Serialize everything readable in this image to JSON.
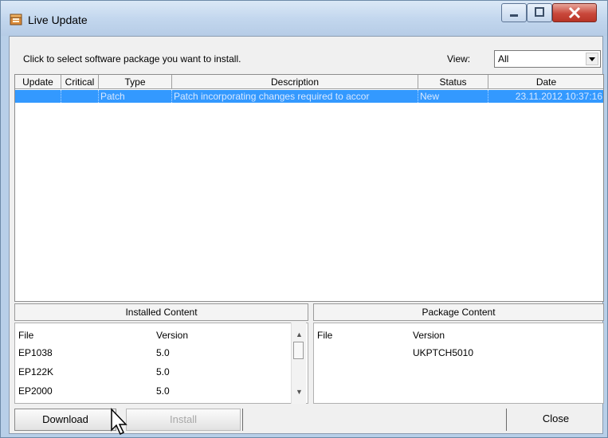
{
  "window": {
    "title": "Live Update",
    "app_icon": "box-package-icon",
    "controls": [
      "minimize-icon",
      "maximize-icon",
      "close-icon"
    ]
  },
  "header": {
    "instruction": "Click to select software package you want  to install.",
    "view_label": "View:",
    "view_value": "All"
  },
  "list": {
    "columns": [
      "Update",
      "Critical",
      "Type",
      "Description",
      "Status",
      "Date"
    ],
    "rows": [
      {
        "update": "",
        "critical": "",
        "type": "Patch",
        "description": "Patch incorporating changes required to accor",
        "status": "New",
        "date": "23.11.2012 10:37:16"
      }
    ]
  },
  "installed": {
    "title": "Installed Content",
    "file_header": "File",
    "version_header": "Version",
    "rows": [
      {
        "file": "EP1038",
        "version": "5.0"
      },
      {
        "file": "EP122K",
        "version": "5.0"
      },
      {
        "file": "EP2000",
        "version": "5.0"
      }
    ]
  },
  "package": {
    "title": "Package Content",
    "file_header": "File",
    "version_header": "Version",
    "rows": [
      {
        "file": "",
        "version": "UKPTCH5010"
      }
    ]
  },
  "footer": {
    "download_label": "Download",
    "install_label": "Install",
    "close_label": "Close"
  },
  "colors": {
    "selection": "#3399ff",
    "selection_text": "#d8e8ff",
    "close_button": "#c9483b"
  }
}
